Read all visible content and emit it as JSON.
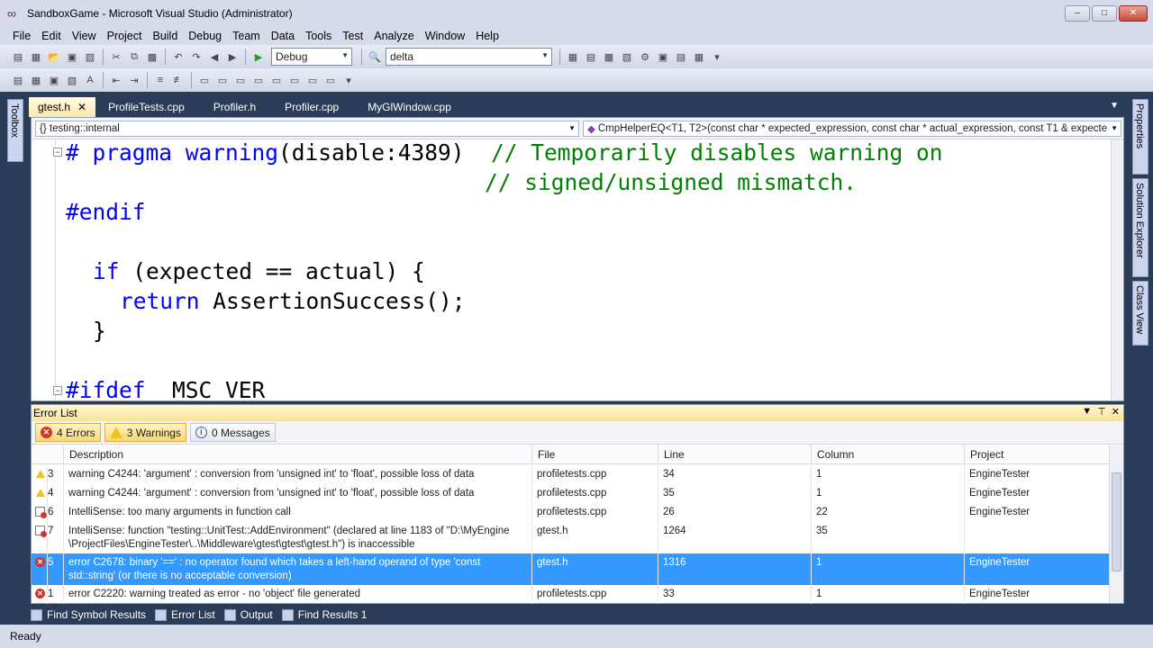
{
  "window": {
    "title": "SandboxGame - Microsoft Visual Studio (Administrator)",
    "buttons": [
      "–",
      "□",
      "✕"
    ]
  },
  "menu": [
    "File",
    "Edit",
    "View",
    "Project",
    "Build",
    "Debug",
    "Team",
    "Data",
    "Tools",
    "Test",
    "Analyze",
    "Window",
    "Help"
  ],
  "toolbar": {
    "config": "Debug",
    "find": "delta"
  },
  "left_tabs": {
    "toolbox": "Toolbox"
  },
  "right_tabs": {
    "properties": "Properties",
    "solution_explorer": "Solution Explorer",
    "class_view": "Class View"
  },
  "doc_tabs": [
    "gtest.h",
    "ProfileTests.cpp",
    "Profiler.h",
    "Profiler.cpp",
    "MyGlWindow.cpp"
  ],
  "editor": {
    "scope": "{} testing::internal",
    "member": "CmpHelperEQ<T1, T2>(const char * expected_expression, const char * actual_expression, const T1 & expecte"
  },
  "code": {
    "l1_pp": "# pragma warning",
    "l1_rest": "(disable:4389)  ",
    "l1_cm": "// Temporarily disables warning on",
    "l2_cm": "// signed/unsigned mismatch.",
    "l3": "#endif",
    "l4_kw": "if",
    "l4_rest": " (expected == actual) {",
    "l5_kw": "return",
    "l5_rest": " AssertionSuccess();",
    "l6": "}",
    "l7_pp": "#ifdef",
    "l7_rest": " _MSC_VER"
  },
  "error_list": {
    "title": "Error List",
    "filters": {
      "errors": "4 Errors",
      "warnings": "3 Warnings",
      "messages": "0 Messages"
    },
    "columns": [
      "Description",
      "File",
      "Line",
      "Column",
      "Project"
    ],
    "rows": [
      {
        "type": "warning",
        "n": "3",
        "desc": "warning C4244: 'argument' : conversion from 'unsigned int' to 'float', possible loss of data",
        "desc2": "",
        "file": "profiletests.cpp",
        "line": "34",
        "col": "1",
        "project": "EngineTester"
      },
      {
        "type": "warning",
        "n": "4",
        "desc": "warning C4244: 'argument' : conversion from 'unsigned int' to 'float', possible loss of data",
        "desc2": "",
        "file": "profiletests.cpp",
        "line": "35",
        "col": "1",
        "project": "EngineTester"
      },
      {
        "type": "intellisense",
        "n": "6",
        "desc": "IntelliSense: too many arguments in function call",
        "desc2": "",
        "file": "profiletests.cpp",
        "line": "26",
        "col": "22",
        "project": "EngineTester"
      },
      {
        "type": "intellisense",
        "n": "7",
        "desc": "IntelliSense: function \"testing::UnitTest::AddEnvironment\" (declared at line 1183 of \"D:\\MyEngine",
        "desc2": "\\ProjectFiles\\EngineTester\\..\\Middleware\\gtest\\gtest\\gtest.h\") is inaccessible",
        "file": "gtest.h",
        "line": "1264",
        "col": "35",
        "project": ""
      },
      {
        "type": "error",
        "n": "5",
        "desc": "error C2678: binary '==' : no operator found which takes a left-hand operand of type 'const",
        "desc2": "std::string' (or there is no acceptable conversion)",
        "file": "gtest.h",
        "line": "1316",
        "col": "1",
        "project": "EngineTester",
        "selected": true
      },
      {
        "type": "error",
        "n": "1",
        "desc": "error C2220: warning treated as error - no 'object' file generated",
        "desc2": "",
        "file": "profiletests.cpp",
        "line": "33",
        "col": "1",
        "project": "EngineTester"
      }
    ]
  },
  "bottom_tabs": [
    "Find Symbol Results",
    "Error List",
    "Output",
    "Find Results 1"
  ],
  "status": "Ready"
}
